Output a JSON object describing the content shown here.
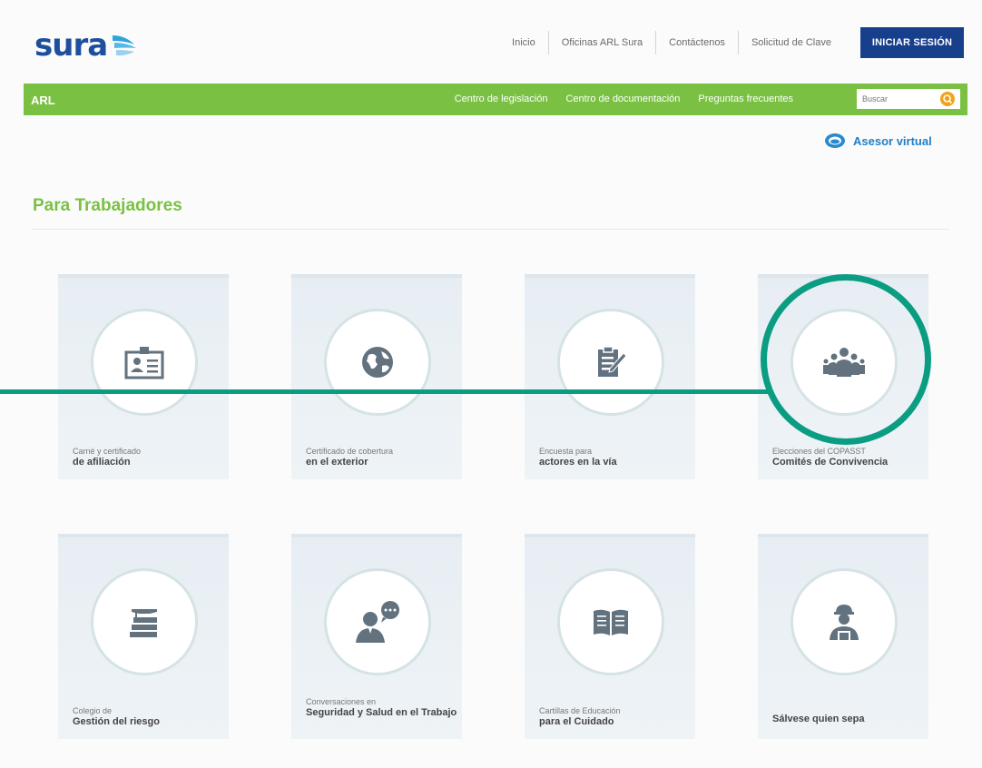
{
  "header": {
    "logo": "sura",
    "nav": [
      "Inicio",
      "Oficinas ARL Sura",
      "Contáctenos",
      "Solicitud de Clave"
    ],
    "login_label": "INICIAR SESIÓN"
  },
  "greenbar": {
    "brand": "ARL",
    "links": [
      "Centro de legislación",
      "Centro de documentación",
      "Preguntas frecuentes"
    ],
    "search_placeholder": "Buscar"
  },
  "asesor": {
    "label": "Asesor virtual"
  },
  "section": {
    "title": "Para Trabajadores"
  },
  "cards": [
    {
      "small": "Carné y certificado",
      "big": "de afiliación",
      "icon": "id-card-icon"
    },
    {
      "small": "Certificado de cobertura",
      "big": "en el exterior",
      "icon": "globe-icon"
    },
    {
      "small": "Encuesta para",
      "big": "actores en la vía",
      "icon": "clipboard-icon"
    },
    {
      "small": "Elecciones del COPASST",
      "big": "Comités de Convivencia",
      "icon": "group-icon"
    },
    {
      "small": "Colegio de",
      "big": "Gestión del riesgo",
      "icon": "books-icon"
    },
    {
      "small": "Conversaciones en",
      "big": "Seguridad y Salud en el Trabajo",
      "icon": "chat-person-icon"
    },
    {
      "small": "Cartillas de Educación",
      "big": "para el Cuidado",
      "icon": "open-book-icon"
    },
    {
      "small": "",
      "big": "Sálvese quien sepa",
      "icon": "worker-icon"
    }
  ],
  "colors": {
    "green": "#7ac143",
    "navy": "#173f8c",
    "teal": "#0a9d82",
    "icon": "#62727e"
  }
}
